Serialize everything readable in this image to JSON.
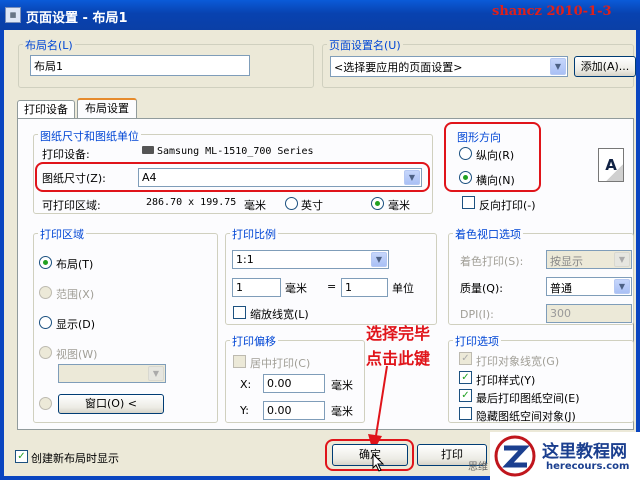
{
  "window": {
    "title": "页面设置 - 布局1",
    "watermark": "shancz 2010-1-3"
  },
  "layout_name": {
    "label": "布局名(L)",
    "value": "布局1"
  },
  "page_setup_name": {
    "label": "页面设置名(U)",
    "value": "<选择要应用的页面设置>",
    "add_button": "添加(A)..."
  },
  "tabs": [
    "打印设备",
    "布局设置"
  ],
  "paper": {
    "group_label": "图纸尺寸和图纸单位",
    "device_label": "打印设备:",
    "device_value": "Samsung ML-1510_700 Series",
    "size_label": "图纸尺寸(Z):",
    "size_value": "A4",
    "printable_label": "可打印区域:",
    "printable_value": "286.70 x 199.75",
    "printable_unit": "毫米",
    "inch_label": "英寸",
    "mm_label": "毫米"
  },
  "orientation": {
    "group_label": "图形方向",
    "portrait": "纵向(R)",
    "landscape": "横向(N)",
    "reverse": "反向打印(-)",
    "icon_letter": "A"
  },
  "plot_area": {
    "group_label": "打印区域",
    "layout": "布局(T)",
    "extents": "范围(X)",
    "display": "显示(D)",
    "view": "视图(W)",
    "window_button": "窗口(O) <"
  },
  "plot_scale": {
    "group_label": "打印比例",
    "scale": "1:1",
    "value1": "1",
    "unit1": "毫米",
    "equals": "=",
    "value2": "1",
    "unit2": "单位",
    "scale_lineweights": "缩放线宽(L)"
  },
  "shaded": {
    "group_label": "着色视口选项",
    "shade_label": "着色打印(S):",
    "shade_value": "按显示",
    "quality_label": "质量(Q):",
    "quality_value": "普通",
    "dpi_label": "DPI(I):",
    "dpi_value": "300"
  },
  "plot_offset": {
    "group_label": "打印偏移",
    "center": "居中打印(C)",
    "x_label": "X:",
    "x_value": "0.00",
    "x_unit": "毫米",
    "y_label": "Y:",
    "y_value": "0.00",
    "y_unit": "毫米"
  },
  "plot_options": {
    "group_label": "打印选项",
    "lineweights": "打印对象线宽(G)",
    "plotstyles": "打印样式(Y)",
    "paperspace_last": "最后打印图纸空间(E)",
    "hide_objects": "隐藏图纸空间对象(J)"
  },
  "footer": {
    "create_new": "创建新布局时显示",
    "ok": "确定",
    "plot": "打印",
    "help": "思维"
  },
  "annotation": {
    "line1": "选择完毕",
    "line2": "点击此键"
  },
  "logo": {
    "title": "这里教程网",
    "url": "herecours.com"
  }
}
